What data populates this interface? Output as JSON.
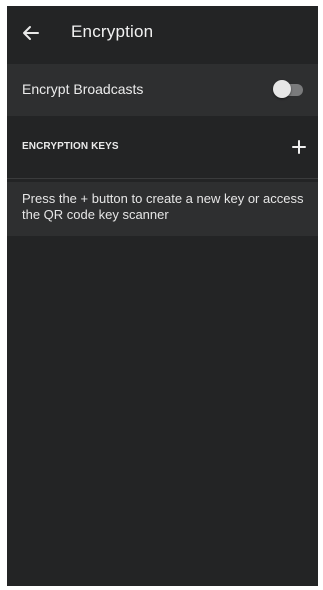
{
  "app_bar": {
    "back_icon": "arrow-left-icon",
    "title": "Encryption"
  },
  "broadcast": {
    "label": "Encrypt Broadcasts",
    "toggle_on": false
  },
  "keys_section": {
    "title": "ENCRYPTION KEYS",
    "add_icon": "plus-icon"
  },
  "hint": {
    "text": "Press the + button to create a new key or access the QR code key scanner"
  },
  "colors": {
    "background": "#232425",
    "row": "#2e2f30",
    "text": "#ececec"
  }
}
